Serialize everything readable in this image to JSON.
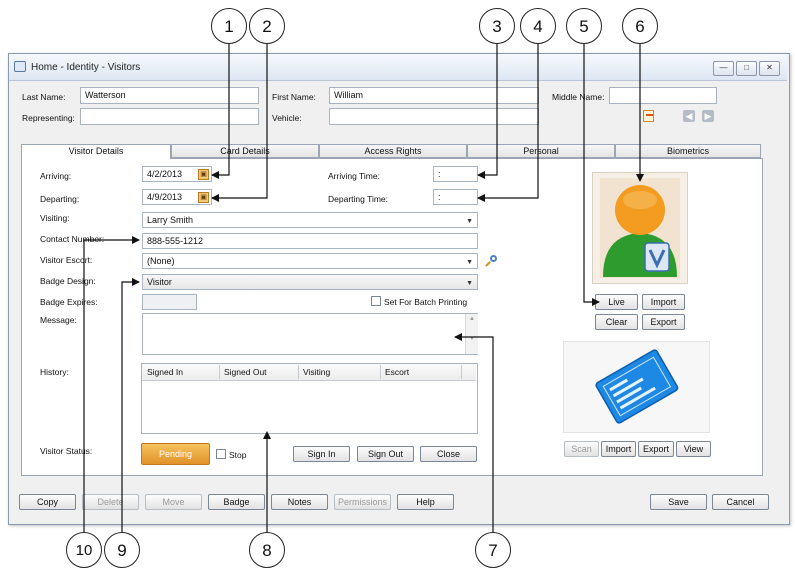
{
  "window": {
    "title": "Home - Identity - Visitors",
    "controls": [
      "minimize-icon",
      "restore-icon",
      "close-icon"
    ]
  },
  "header_fields": {
    "last_name": {
      "label": "Last Name:",
      "value": "Watterson"
    },
    "first_name": {
      "label": "First Name:",
      "value": "William"
    },
    "middle_name": {
      "label": "Middle Name:",
      "value": ""
    },
    "representing": {
      "label": "Representing:",
      "value": ""
    },
    "vehicle": {
      "label": "Vehicle:",
      "value": ""
    }
  },
  "tabs": [
    {
      "label": "Visitor Details",
      "active": true
    },
    {
      "label": "Card Details",
      "active": false
    },
    {
      "label": "Access Rights",
      "active": false
    },
    {
      "label": "Personal",
      "active": false
    },
    {
      "label": "Biometrics",
      "active": false
    }
  ],
  "details": {
    "arriving": {
      "label": "Arriving:",
      "value": "4/2/2013"
    },
    "departing": {
      "label": "Departing:",
      "value": "4/9/2013"
    },
    "arriving_time": {
      "label": "Arriving Time:",
      "value": ":"
    },
    "departing_time": {
      "label": "Departing Time:",
      "value": ":"
    },
    "visiting": {
      "label": "Visiting:",
      "value": "Larry Smith"
    },
    "contact_number": {
      "label": "Contact Number:",
      "value": "888-555-1212"
    },
    "visitor_escort": {
      "label": "Visitor Escort:",
      "value": "(None)"
    },
    "badge_design": {
      "label": "Badge Design:",
      "value": "Visitor"
    },
    "badge_expires": {
      "label": "Badge Expires:",
      "value": ""
    },
    "batch_print": {
      "label": "Set For Batch Printing",
      "checked": false
    },
    "message": {
      "label": "Message:",
      "value": ""
    },
    "history": {
      "label": "History:",
      "columns": [
        "Signed In",
        "Signed Out",
        "Visiting",
        "Escort"
      ],
      "rows": []
    },
    "visitor_status": {
      "label": "Visitor Status:",
      "status": "Pending",
      "stop_label": "Stop",
      "stop_checked": false
    }
  },
  "action_buttons": {
    "sign_in": "Sign In",
    "sign_out": "Sign Out",
    "close": "Close"
  },
  "photo_buttons": {
    "live": "Live",
    "import": "Import",
    "clear": "Clear",
    "export": "Export"
  },
  "card_buttons": {
    "scan": "Scan",
    "import": "Import",
    "export": "Export",
    "view": "View"
  },
  "bottom_buttons": {
    "copy": "Copy",
    "delete": "Delete",
    "move": "Move",
    "badge": "Badge",
    "notes": "Notes",
    "permissions": "Permissions",
    "help": "Help",
    "save": "Save",
    "cancel": "Cancel"
  },
  "callouts": [
    "1",
    "2",
    "3",
    "4",
    "5",
    "6",
    "7",
    "8",
    "9",
    "10"
  ],
  "colors": {
    "status_pending": "#e8a030",
    "accent_card": "#1e88e5",
    "avatar_head": "#f39c1f",
    "avatar_body": "#2e9b2e"
  }
}
